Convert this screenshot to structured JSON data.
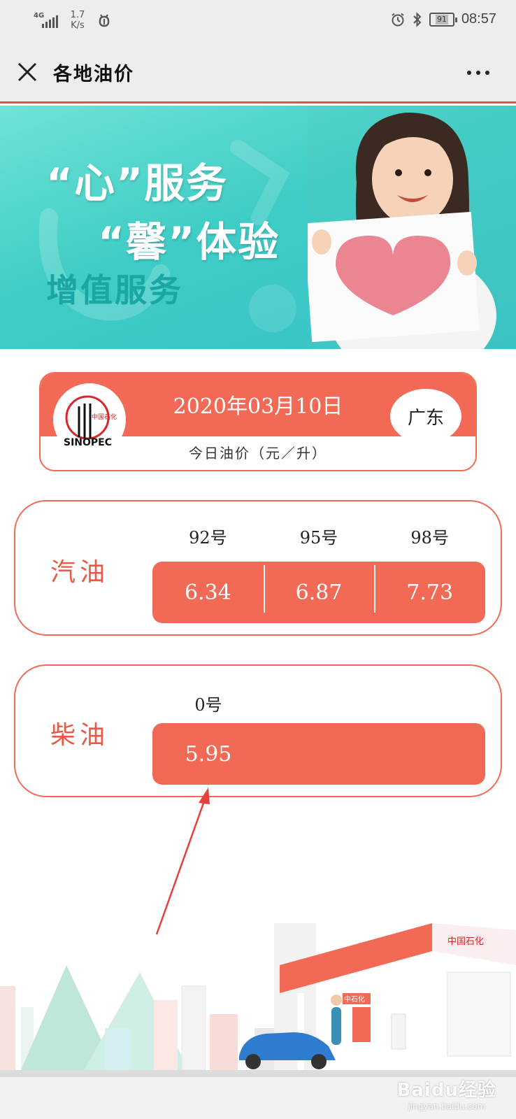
{
  "status_bar": {
    "network": "4G",
    "speed_value": "1.7",
    "speed_unit": "K/s",
    "battery": "91",
    "time": "08:57"
  },
  "header": {
    "title": "各地油价"
  },
  "banner": {
    "line1": "“心”服务",
    "line2": "“馨”体验",
    "line3": "增值服务"
  },
  "price_header": {
    "date": "2020年03月10日",
    "province": "广东",
    "unit_label": "今日油价（元／升）",
    "logo_cn": "中国石化",
    "logo_en": "SINOPEC"
  },
  "gasoline": {
    "label": "汽油",
    "grades": [
      "92号",
      "95号",
      "98号"
    ],
    "prices": [
      "6.34",
      "6.87",
      "7.73"
    ]
  },
  "diesel": {
    "label": "柴油",
    "grades": [
      "0号"
    ],
    "prices": [
      "5.95"
    ]
  },
  "scene": {
    "station_sign": "中国石化",
    "pump_sign": "中石化"
  },
  "watermark": {
    "brand": "Baidu经验",
    "site": "jingyan.baidu.com"
  },
  "colors": {
    "accent": "#f26a55",
    "banner_teal": "#40cdc6",
    "header_bg": "#ededed"
  }
}
